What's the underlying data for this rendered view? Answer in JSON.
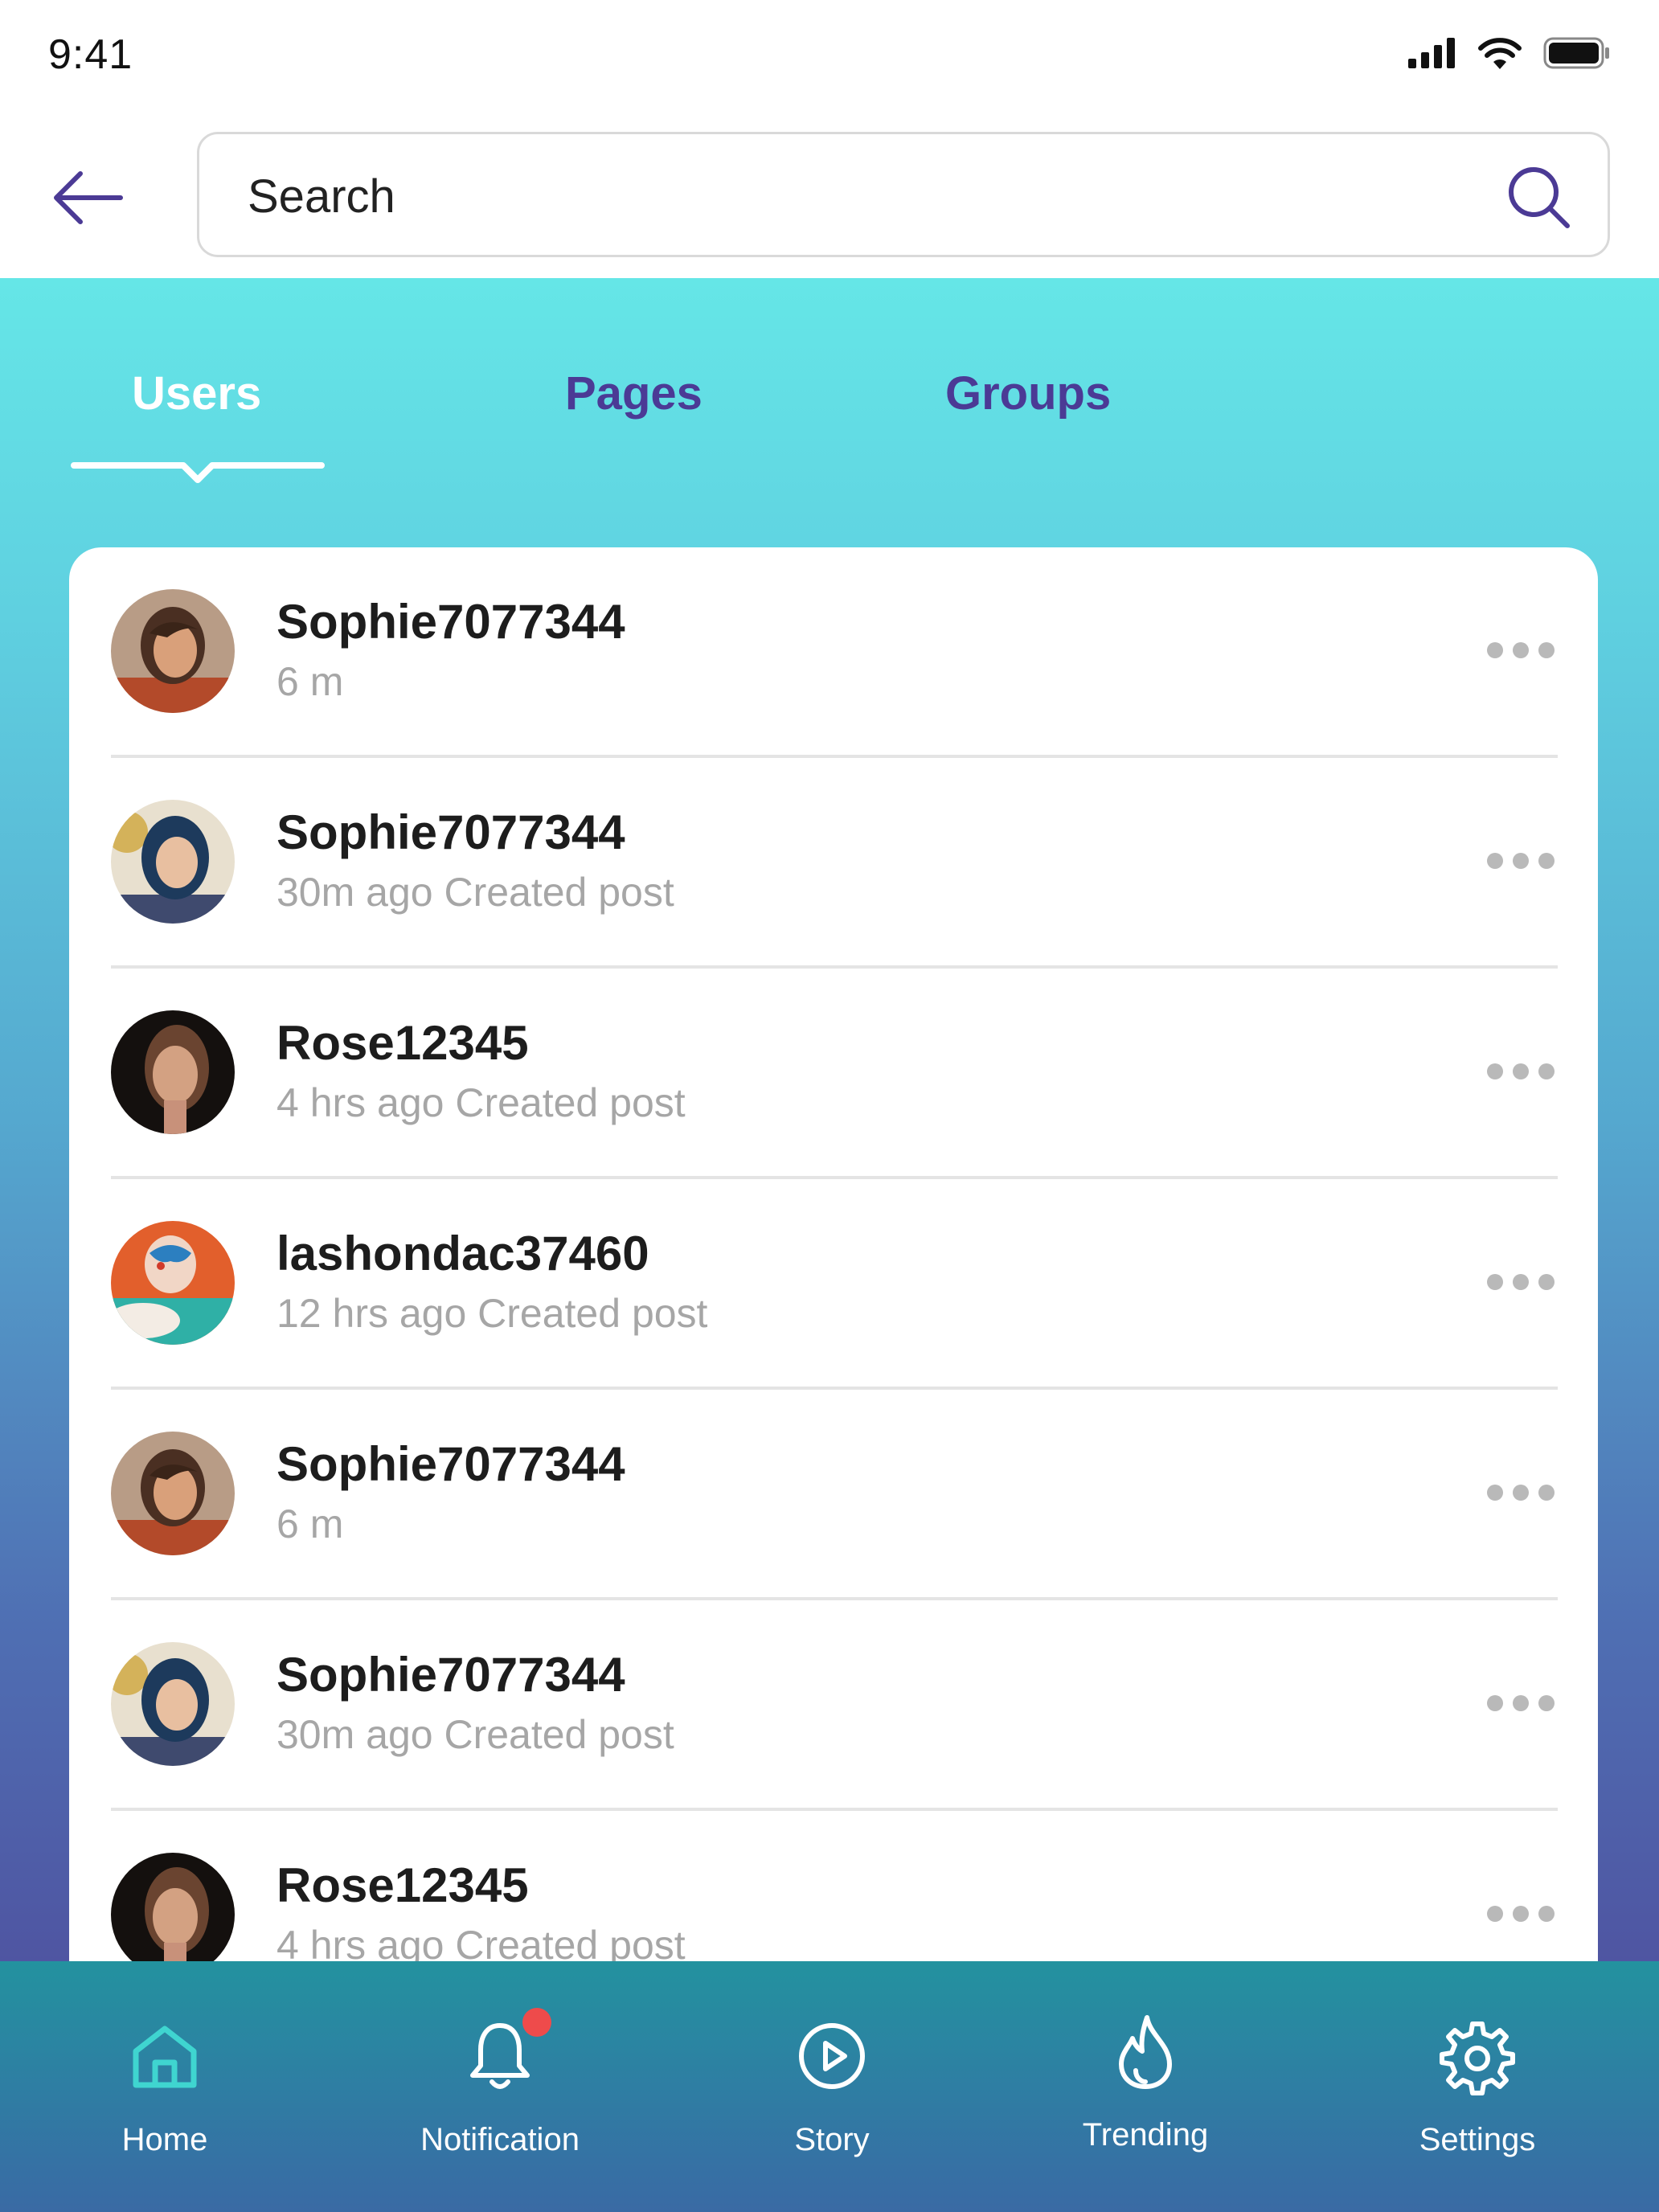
{
  "status_bar": {
    "time": "9:41"
  },
  "search": {
    "placeholder": "Search",
    "value": ""
  },
  "tabs": [
    {
      "label": "Users",
      "active": true
    },
    {
      "label": "Pages",
      "active": false
    },
    {
      "label": "Groups",
      "active": false
    }
  ],
  "users": [
    {
      "name": "Sophie7077344",
      "sub": "6 m",
      "avatar": "avatar-woman-brown-hair"
    },
    {
      "name": "Sophie7077344",
      "sub": "30m ago Created post",
      "avatar": "avatar-woman-blue-hair"
    },
    {
      "name": "Rose12345",
      "sub": "4 hrs ago Created post",
      "avatar": "avatar-woman-dark-background"
    },
    {
      "name": "lashondac37460",
      "sub": "12 hrs ago Created post",
      "avatar": "avatar-child-face-paint"
    },
    {
      "name": "Sophie7077344",
      "sub": "6 m",
      "avatar": "avatar-woman-brown-hair"
    },
    {
      "name": "Sophie7077344",
      "sub": "30m ago Created post",
      "avatar": "avatar-woman-blue-hair"
    },
    {
      "name": "Rose12345",
      "sub": "4 hrs ago Created post",
      "avatar": "avatar-woman-dark-background"
    }
  ],
  "bottom_nav": [
    {
      "label": "Home",
      "icon": "home-icon",
      "active": true
    },
    {
      "label": "Notification",
      "icon": "bell-icon",
      "active": false,
      "badge": true
    },
    {
      "label": "Story",
      "icon": "play-circle-icon",
      "active": false
    },
    {
      "label": "Trending",
      "icon": "flame-icon",
      "active": false
    },
    {
      "label": "Settings",
      "icon": "gear-icon",
      "active": false
    }
  ],
  "colors": {
    "accent": "#4b3a95",
    "gradient_top": "#65e6e7",
    "gradient_bottom": "#4f55a2",
    "nav_bg": "#2e7ea3",
    "home_active": "#3fd5d0",
    "badge": "#ee4b4b"
  }
}
